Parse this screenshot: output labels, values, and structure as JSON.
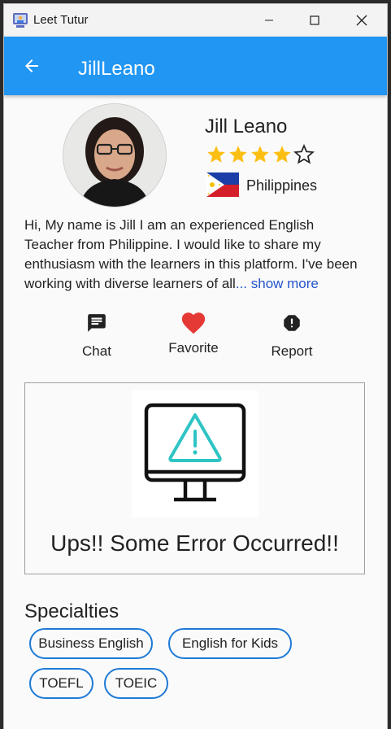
{
  "window": {
    "title": "Leet Tutur",
    "controls": [
      "minimize-icon",
      "maximize-icon",
      "close-icon"
    ]
  },
  "appbar": {
    "title": "JillLeano",
    "back_icon": "arrow-back-icon",
    "color": "#2196f3"
  },
  "profile": {
    "name": "Jill Leano",
    "rating": 4,
    "rating_max": 5,
    "country": "Philippines",
    "bio": "Hi, My name is Jill I am an experienced English Teacher from Philippine. I would like to share my enthusiasm with the learners in this platform. I've been working with diverse learners of all",
    "show_more": "... show more"
  },
  "actions": [
    {
      "label": "Chat",
      "icon": "chat-icon"
    },
    {
      "label": "Favorite",
      "icon": "heart-icon"
    },
    {
      "label": "Report",
      "icon": "report-icon"
    }
  ],
  "error": {
    "message": "Ups!! Some Error Occurred!!",
    "icon": "monitor-warning-icon"
  },
  "specialties": {
    "title": "Specialties",
    "items": [
      "Business English",
      "English for Kids",
      "TOEFL",
      "TOEIC"
    ]
  },
  "colors": {
    "accent": "#2196f3",
    "star": "#fbbf14",
    "heart": "#e53935",
    "chip_border": "#1f7ad6"
  }
}
